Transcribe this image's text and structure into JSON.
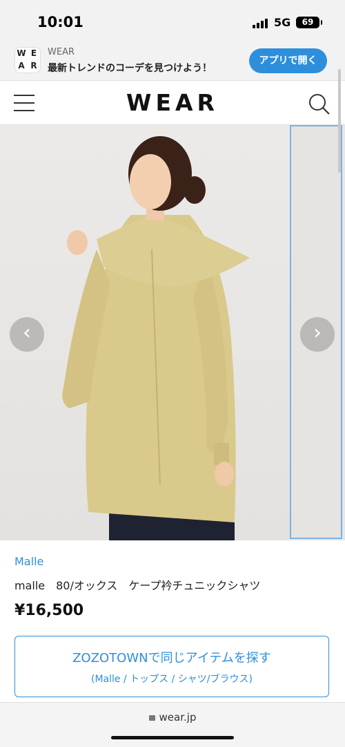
{
  "status_bar": {
    "time": "10:01",
    "network": "5G",
    "battery": "69"
  },
  "app_banner": {
    "logo_letters": [
      "W",
      "E",
      "A",
      "R"
    ],
    "app_name": "WEAR",
    "tagline": "最新トレンドのコーデを見つけよう！",
    "open_button": "アプリで開く"
  },
  "header": {
    "logo": "WEAR"
  },
  "gallery": {
    "prev_arrow": "‹",
    "next_arrow": "›"
  },
  "product": {
    "brand": "Malle",
    "title": "malle　80/オックス　ケープ衿チュニックシャツ",
    "price": "¥16,500"
  },
  "zozo_button": {
    "label": "ZOZOTOWNで同じアイテムを探す",
    "category": "(Malle / トップス / シャツ/ブラウス)"
  },
  "browser": {
    "url": "wear.jp"
  },
  "colors": {
    "accent": "#2d8fdc",
    "shirt": "#d8c98a"
  }
}
